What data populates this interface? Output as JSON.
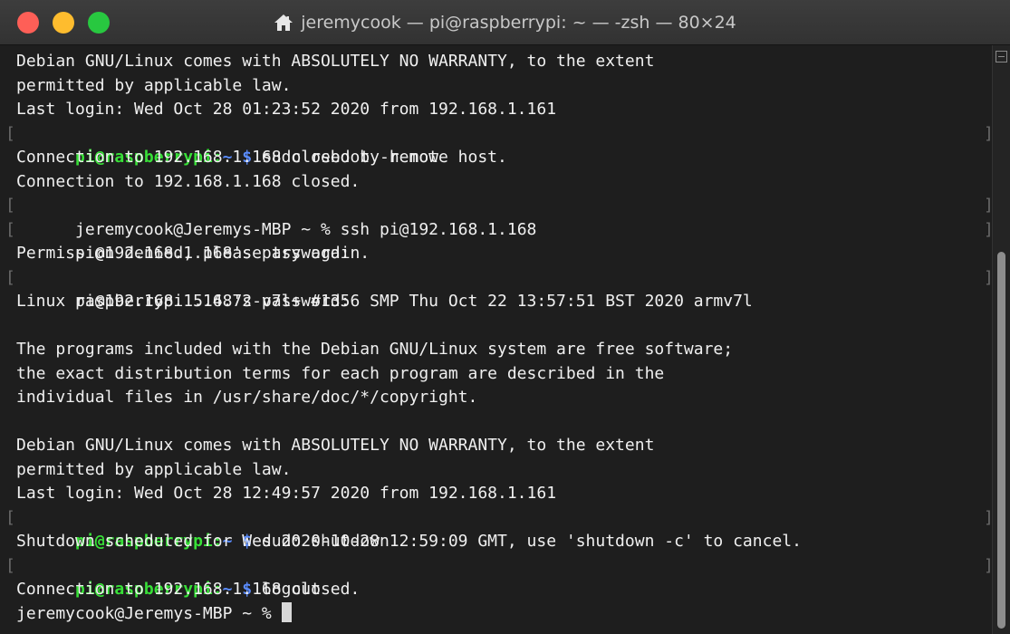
{
  "window": {
    "title": "jeremycook — pi@raspberrypi: ~ — -zsh — 80×24"
  },
  "terminal": {
    "colors": {
      "background": "#1e1e1e",
      "text": "#f0f0f0",
      "prompt_host": "#38e038",
      "prompt_path": "#5a8cff"
    },
    "lines": {
      "l1": "Debian GNU/Linux comes with ABSOLUTELY NO WARRANTY, to the extent",
      "l2": "permitted by applicable law.",
      "l3": "Last login: Wed Oct 28 01:23:52 2020 from 192.168.1.161",
      "l4": {
        "host": "pi@raspberrypi:",
        "path": "~ $",
        "command": " sudo reboot -h now"
      },
      "l5": "Connection to 192.168.1.168 closed by remote host.",
      "l6": "Connection to 192.168.1.168 closed.",
      "l7": "jeremycook@Jeremys-MBP ~ % ssh pi@192.168.1.168",
      "l8": "pi@192.168.1.168's password:",
      "l9": "Permission denied, please try again.",
      "l10": "pi@192.168.1.168's password:",
      "l11": "Linux raspberrypi 5.4.72-v7l+ #1356 SMP Thu Oct 22 13:57:51 BST 2020 armv7l",
      "l12": "",
      "l13": "The programs included with the Debian GNU/Linux system are free software;",
      "l14": "the exact distribution terms for each program are described in the",
      "l15": "individual files in /usr/share/doc/*/copyright.",
      "l16": "",
      "l17": "Debian GNU/Linux comes with ABSOLUTELY NO WARRANTY, to the extent",
      "l18": "permitted by applicable law.",
      "l19": "Last login: Wed Oct 28 12:49:57 2020 from 192.168.1.161",
      "l20": {
        "host": "pi@raspberrypi:",
        "path": "~ $",
        "command": " sudo shutdown"
      },
      "l21": "Shutdown scheduled for Wed 2020-10-28 12:59:09 GMT, use 'shutdown -c' to cancel.",
      "l22": {
        "host": "pi@raspberrypi:",
        "path": "~ $",
        "command": " logout"
      },
      "l23": "Connection to 192.168.1.168 closed.",
      "l24": "jeremycook@Jeremys-MBP ~ % "
    },
    "mark_open": "[",
    "mark_close": "]"
  },
  "icons": {
    "title": "home-icon",
    "scroll_marker": "bookmark-icon"
  }
}
